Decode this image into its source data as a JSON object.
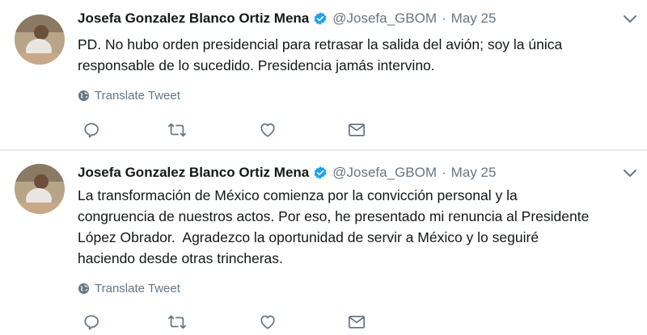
{
  "tweets": [
    {
      "author_name": "Josefa Gonzalez Blanco Ortiz Mena",
      "handle": "@Josefa_GBOM",
      "separator": "·",
      "date": "May 25",
      "text_lines": [
        "PD. No hubo orden presidencial para retrasar la salida del avión; soy la única",
        "responsable de lo sucedido. Presidencia jamás intervino."
      ],
      "translate_label": "Translate Tweet"
    },
    {
      "author_name": "Josefa Gonzalez Blanco Ortiz Mena",
      "handle": "@Josefa_GBOM",
      "separator": "·",
      "date": "May 25",
      "text_lines": [
        "La transformación de México comienza por la convicción personal y la",
        "congruencia de nuestros actos. Por eso, he presentado mi renuncia al Presidente",
        "López Obrador.  Agradezco la oportunidad de servir a México y lo seguiré",
        "haciendo desde otras trincheras."
      ],
      "translate_label": "Translate Tweet"
    }
  ],
  "icons": {
    "verified": "verified-badge-icon",
    "caret": "chevron-down-icon",
    "globe": "globe-icon",
    "reply": "reply-icon",
    "retweet": "retweet-icon",
    "like": "heart-icon",
    "message": "envelope-icon"
  },
  "colors": {
    "verified_blue": "#1da1f2",
    "secondary_text": "#657786",
    "primary_text": "#14171a",
    "divider": "#e6ecf0"
  }
}
